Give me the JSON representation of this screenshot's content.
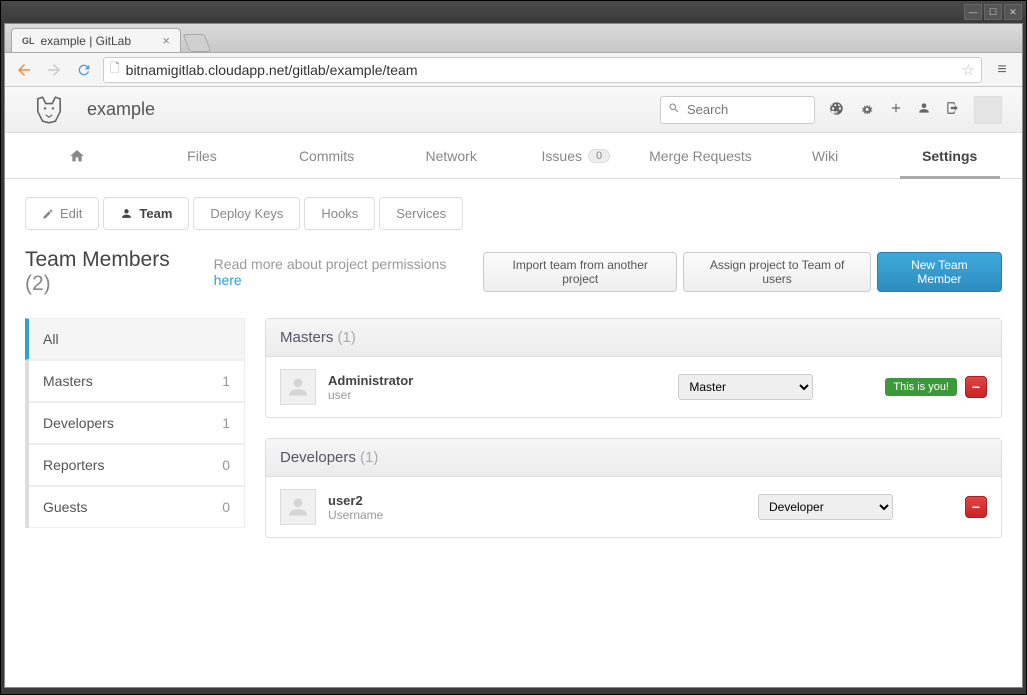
{
  "browser": {
    "tab_title": "example | GitLab",
    "url": "bitnamigitlab.cloudapp.net/gitlab/example/team"
  },
  "header": {
    "project_title": "example",
    "search_placeholder": "Search"
  },
  "main_nav": {
    "home": "",
    "files": "Files",
    "commits": "Commits",
    "network": "Network",
    "issues": "Issues",
    "issues_count": "0",
    "merge_requests": "Merge Requests",
    "wiki": "Wiki",
    "settings": "Settings"
  },
  "subtabs": {
    "edit": "Edit",
    "team": "Team",
    "deploy_keys": "Deploy Keys",
    "hooks": "Hooks",
    "services": "Services"
  },
  "page": {
    "title": "Team Members",
    "count": "(2)",
    "readmore_text": "Read more about project permissions",
    "readmore_link": "here"
  },
  "actions": {
    "import": "Import team from another project",
    "assign": "Assign project to Team of users",
    "new_member": "New Team Member"
  },
  "sidebar": {
    "all": {
      "label": "All"
    },
    "masters": {
      "label": "Masters",
      "count": "1"
    },
    "developers": {
      "label": "Developers",
      "count": "1"
    },
    "reporters": {
      "label": "Reporters",
      "count": "0"
    },
    "guests": {
      "label": "Guests",
      "count": "0"
    }
  },
  "groups": {
    "masters": {
      "title": "Masters",
      "count": "(1)",
      "members": [
        {
          "name": "Administrator",
          "sub": "user",
          "role": "Master",
          "you": "This is you!"
        }
      ]
    },
    "developers": {
      "title": "Developers",
      "count": "(1)",
      "members": [
        {
          "name": "user2",
          "sub": "Username",
          "role": "Developer"
        }
      ]
    }
  }
}
